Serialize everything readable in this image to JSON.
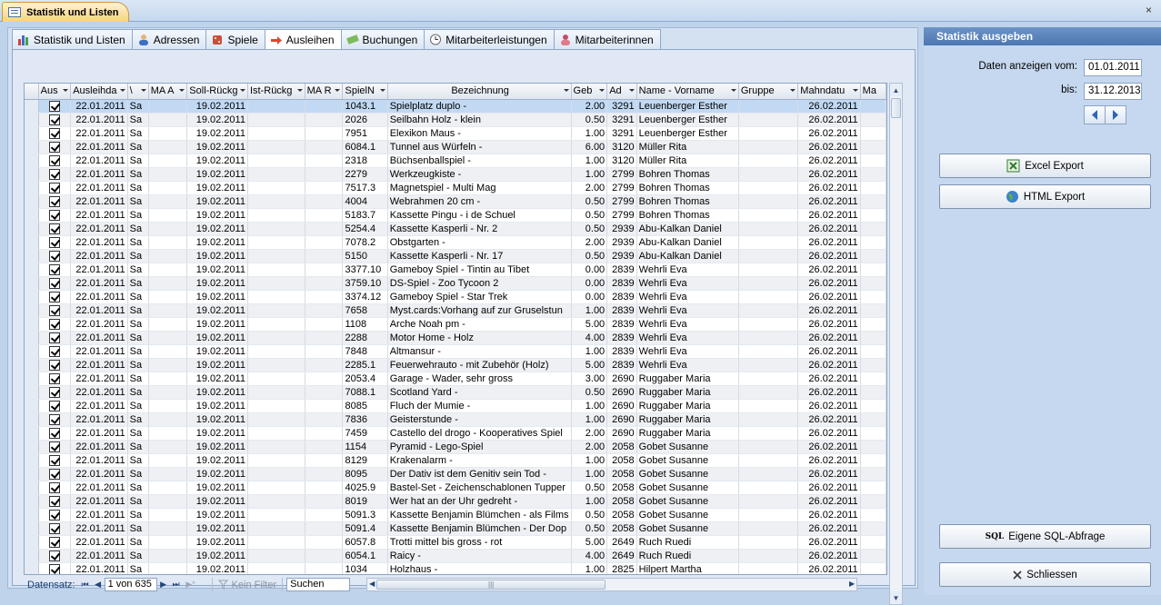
{
  "document_tab": {
    "title": "Statistik und Listen",
    "close_symbol": "×"
  },
  "tabs": [
    {
      "label": "Statistik und Listen",
      "icon": "bar-chart-icon"
    },
    {
      "label": "Adressen",
      "icon": "person-icon"
    },
    {
      "label": "Spiele",
      "icon": "dice-icon"
    },
    {
      "label": "Ausleihen",
      "icon": "arrow-right-icon",
      "active": true
    },
    {
      "label": "Buchungen",
      "icon": "money-icon"
    },
    {
      "label": "Mitarbeiterleistungen",
      "icon": "clock-icon"
    },
    {
      "label": "Mitarbeiterinnen",
      "icon": "woman-icon"
    }
  ],
  "grid": {
    "columns": [
      "Aus",
      "Ausleihda",
      "\\",
      "MA A",
      "Soll-Rückg",
      "Ist-Rückg",
      "MA R",
      "SpielN",
      "Bezeichnung",
      "Geb",
      "Ad",
      "Name - Vorname",
      "Gruppe",
      "Mahndatu",
      "Ma"
    ],
    "rows": [
      [
        "22.01.2011",
        "Sa",
        "19.02.2011",
        "1043.1",
        "Spielplatz duplo -",
        "2.00",
        "3291",
        "Leuenberger Esther",
        "26.02.2011"
      ],
      [
        "22.01.2011",
        "Sa",
        "19.02.2011",
        "2026",
        "Seilbahn Holz - klein",
        "0.50",
        "3291",
        "Leuenberger Esther",
        "26.02.2011"
      ],
      [
        "22.01.2011",
        "Sa",
        "19.02.2011",
        "7951",
        "Elexikon Maus -",
        "1.00",
        "3291",
        "Leuenberger Esther",
        "26.02.2011"
      ],
      [
        "22.01.2011",
        "Sa",
        "19.02.2011",
        "6084.1",
        "Tunnel aus Würfeln -",
        "6.00",
        "3120",
        "Müller Rita",
        "26.02.2011"
      ],
      [
        "22.01.2011",
        "Sa",
        "19.02.2011",
        "2318",
        "Büchsenballspiel -",
        "1.00",
        "3120",
        "Müller Rita",
        "26.02.2011"
      ],
      [
        "22.01.2011",
        "Sa",
        "19.02.2011",
        "2279",
        "Werkzeugkiste -",
        "1.00",
        "2799",
        "Bohren Thomas",
        "26.02.2011"
      ],
      [
        "22.01.2011",
        "Sa",
        "19.02.2011",
        "7517.3",
        "Magnetspiel - Multi Mag",
        "2.00",
        "2799",
        "Bohren Thomas",
        "26.02.2011"
      ],
      [
        "22.01.2011",
        "Sa",
        "19.02.2011",
        "4004",
        "Webrahmen 20 cm -",
        "0.50",
        "2799",
        "Bohren Thomas",
        "26.02.2011"
      ],
      [
        "22.01.2011",
        "Sa",
        "19.02.2011",
        "5183.7",
        "Kassette Pingu - i de Schuel",
        "0.50",
        "2799",
        "Bohren Thomas",
        "26.02.2011"
      ],
      [
        "22.01.2011",
        "Sa",
        "19.02.2011",
        "5254.4",
        "Kassette Kasperli - Nr. 2",
        "0.50",
        "2939",
        "Abu-Kalkan Daniel",
        "26.02.2011"
      ],
      [
        "22.01.2011",
        "Sa",
        "19.02.2011",
        "7078.2",
        "Obstgarten -",
        "2.00",
        "2939",
        "Abu-Kalkan Daniel",
        "26.02.2011"
      ],
      [
        "22.01.2011",
        "Sa",
        "19.02.2011",
        "5150",
        "Kassette Kasperli - Nr. 17",
        "0.50",
        "2939",
        "Abu-Kalkan Daniel",
        "26.02.2011"
      ],
      [
        "22.01.2011",
        "Sa",
        "19.02.2011",
        "3377.10",
        "Gameboy Spiel - Tintin au Tibet",
        "0.00",
        "2839",
        "Wehrli Eva",
        "26.02.2011"
      ],
      [
        "22.01.2011",
        "Sa",
        "19.02.2011",
        "3759.10",
        "DS-Spiel - Zoo Tycoon 2",
        "0.00",
        "2839",
        "Wehrli Eva",
        "26.02.2011"
      ],
      [
        "22.01.2011",
        "Sa",
        "19.02.2011",
        "3374.12",
        "Gameboy Spiel - Star Trek",
        "0.00",
        "2839",
        "Wehrli Eva",
        "26.02.2011"
      ],
      [
        "22.01.2011",
        "Sa",
        "19.02.2011",
        "7658",
        "Myst.cards:Vorhang auf zur Gruselstun",
        "1.00",
        "2839",
        "Wehrli Eva",
        "26.02.2011"
      ],
      [
        "22.01.2011",
        "Sa",
        "19.02.2011",
        "1108",
        "Arche Noah pm -",
        "5.00",
        "2839",
        "Wehrli Eva",
        "26.02.2011"
      ],
      [
        "22.01.2011",
        "Sa",
        "19.02.2011",
        "2288",
        "Motor Home - Holz",
        "4.00",
        "2839",
        "Wehrli Eva",
        "26.02.2011"
      ],
      [
        "22.01.2011",
        "Sa",
        "19.02.2011",
        "7848",
        "Altmansur -",
        "1.00",
        "2839",
        "Wehrli Eva",
        "26.02.2011"
      ],
      [
        "22.01.2011",
        "Sa",
        "19.02.2011",
        "2285.1",
        "Feuerwehrauto - mit Zubehör  (Holz)",
        "5.00",
        "2839",
        "Wehrli Eva",
        "26.02.2011"
      ],
      [
        "22.01.2011",
        "Sa",
        "19.02.2011",
        "2053.4",
        "Garage - Wader, sehr gross",
        "3.00",
        "2690",
        "Ruggaber Maria",
        "26.02.2011"
      ],
      [
        "22.01.2011",
        "Sa",
        "19.02.2011",
        "7088.1",
        "Scotland Yard -",
        "0.50",
        "2690",
        "Ruggaber Maria",
        "26.02.2011"
      ],
      [
        "22.01.2011",
        "Sa",
        "19.02.2011",
        "8085",
        "Fluch der Mumie -",
        "1.00",
        "2690",
        "Ruggaber Maria",
        "26.02.2011"
      ],
      [
        "22.01.2011",
        "Sa",
        "19.02.2011",
        "7836",
        "Geisterstunde -",
        "1.00",
        "2690",
        "Ruggaber Maria",
        "26.02.2011"
      ],
      [
        "22.01.2011",
        "Sa",
        "19.02.2011",
        "7459",
        "Castello del drogo - Kooperatives Spiel",
        "2.00",
        "2690",
        "Ruggaber Maria",
        "26.02.2011"
      ],
      [
        "22.01.2011",
        "Sa",
        "19.02.2011",
        "1154",
        "Pyramid - Lego-Spiel",
        "2.00",
        "2058",
        "Gobet Susanne",
        "26.02.2011"
      ],
      [
        "22.01.2011",
        "Sa",
        "19.02.2011",
        "8129",
        "Krakenalarm -",
        "1.00",
        "2058",
        "Gobet Susanne",
        "26.02.2011"
      ],
      [
        "22.01.2011",
        "Sa",
        "19.02.2011",
        "8095",
        "Der Dativ ist dem Genitiv sein Tod -",
        "1.00",
        "2058",
        "Gobet Susanne",
        "26.02.2011"
      ],
      [
        "22.01.2011",
        "Sa",
        "19.02.2011",
        "4025.9",
        "Bastel-Set - Zeichenschablonen Tupper",
        "0.50",
        "2058",
        "Gobet Susanne",
        "26.02.2011"
      ],
      [
        "22.01.2011",
        "Sa",
        "19.02.2011",
        "8019",
        "Wer hat an der Uhr gedreht -",
        "1.00",
        "2058",
        "Gobet Susanne",
        "26.02.2011"
      ],
      [
        "22.01.2011",
        "Sa",
        "19.02.2011",
        "5091.3",
        "Kassette Benjamin Blümchen - als Films",
        "0.50",
        "2058",
        "Gobet Susanne",
        "26.02.2011"
      ],
      [
        "22.01.2011",
        "Sa",
        "19.02.2011",
        "5091.4",
        "Kassette Benjamin Blümchen - Der Dop",
        "0.50",
        "2058",
        "Gobet Susanne",
        "26.02.2011"
      ],
      [
        "22.01.2011",
        "Sa",
        "19.02.2011",
        "6057.8",
        "Trotti  mittel bis gross - rot",
        "5.00",
        "2649",
        "Ruch Ruedi",
        "26.02.2011"
      ],
      [
        "22.01.2011",
        "Sa",
        "19.02.2011",
        "6054.1",
        "Raicy -",
        "4.00",
        "2649",
        "Ruch Ruedi",
        "26.02.2011"
      ],
      [
        "22.01.2011",
        "Sa",
        "19.02.2011",
        "1034",
        "Holzhaus -",
        "1.00",
        "2825",
        "Hilpert Martha",
        "26.02.2011"
      ]
    ]
  },
  "navigation": {
    "label": "Datensatz:",
    "record": "1 von 635",
    "first": "⏮",
    "prev": "◀",
    "next": "▶",
    "last": "⏭",
    "new": "▶*",
    "filter_label": "Kein Filter",
    "search_label": "Suchen"
  },
  "right_panel": {
    "header": "Statistik ausgeben",
    "from_label": "Daten anzeigen vom:",
    "from_value": "01.01.2011",
    "to_label": "bis:",
    "to_value": "31.12.2013",
    "excel_label": "Excel Export",
    "html_label": "HTML Export",
    "sql_label": "Eigene SQL-Abfrage",
    "sql_prefix": "SQL",
    "close_label": "Schliessen"
  }
}
